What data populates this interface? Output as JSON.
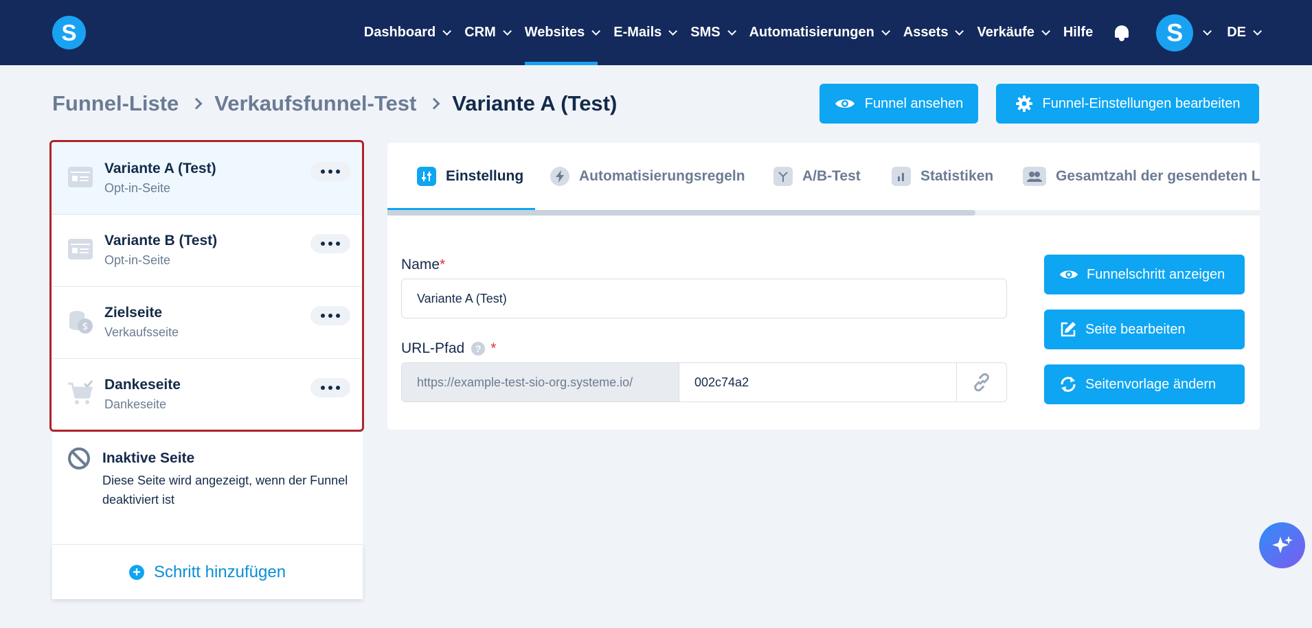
{
  "nav": {
    "items": [
      {
        "label": "Dashboard",
        "chevron": true,
        "active": false
      },
      {
        "label": "CRM",
        "chevron": true,
        "active": false
      },
      {
        "label": "Websites",
        "chevron": true,
        "active": true
      },
      {
        "label": "E-Mails",
        "chevron": true,
        "active": false
      },
      {
        "label": "SMS",
        "chevron": true,
        "active": false
      },
      {
        "label": "Automatisierungen",
        "chevron": true,
        "active": false
      },
      {
        "label": "Assets",
        "chevron": true,
        "active": false
      },
      {
        "label": "Verkäufe",
        "chevron": true,
        "active": false
      },
      {
        "label": "Hilfe",
        "chevron": false,
        "active": false
      }
    ],
    "logo_letter": "S",
    "avatar_letter": "S",
    "language": "DE"
  },
  "breadcrumb": {
    "items": [
      "Funnel-Liste",
      "Verkaufsfunnel-Test"
    ],
    "current": "Variante A (Test)"
  },
  "header": {
    "view_funnel": "Funnel ansehen",
    "edit_settings": "Funnel-Einstellungen bearbeiten"
  },
  "steps": [
    {
      "title": "Variante A (Test)",
      "subtitle": "Opt-in-Seite",
      "icon": "optin-page-icon",
      "selected": true
    },
    {
      "title": "Variante B (Test)",
      "subtitle": "Opt-in-Seite",
      "icon": "optin-page-icon",
      "selected": false
    },
    {
      "title": "Zielseite",
      "subtitle": "Verkaufsseite",
      "icon": "coins-icon",
      "selected": false
    },
    {
      "title": "Dankeseite",
      "subtitle": "Dankeseite",
      "icon": "cart-check-icon",
      "selected": false
    }
  ],
  "inactive": {
    "title": "Inaktive Seite",
    "description": "Diese Seite wird angezeigt, wenn der Funnel deaktiviert ist"
  },
  "add_step": "Schritt hinzufügen",
  "tabs": [
    {
      "label": "Einstellung",
      "icon": "sliders-icon",
      "active": true
    },
    {
      "label": "Automatisierungsregeln",
      "icon": "bolt-icon",
      "active": false
    },
    {
      "label": "A/B-Test",
      "icon": "split-icon",
      "active": false
    },
    {
      "label": "Statistiken",
      "icon": "bar-chart-icon",
      "active": false
    },
    {
      "label": "Gesamtzahl der gesendeten L",
      "icon": "users-icon",
      "active": false
    }
  ],
  "form": {
    "name_label": "Name",
    "name_value": "Variante A (Test)",
    "url_label": "URL-Pfad",
    "url_prefix": "https://example-test-sio-org.systeme.io/",
    "url_slug": "002c74a2",
    "help_glyph": "?",
    "required_mark": "*"
  },
  "actions": {
    "show_step": "Funnelschritt anzeigen",
    "edit_page": "Seite bearbeiten",
    "change_template": "Seitenvorlage ändern"
  },
  "colors": {
    "nav_bg": "#142a5c",
    "primary": "#0ea5f2",
    "highlight": "#b0232a"
  }
}
